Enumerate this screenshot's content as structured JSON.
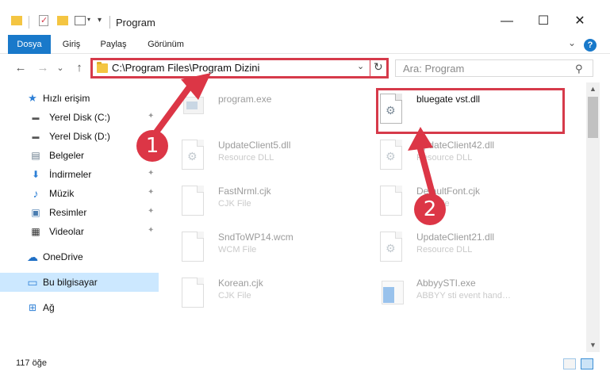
{
  "window": {
    "title": "Program",
    "minimize_glyph": "—",
    "maximize_glyph": "☐",
    "close_glyph": "✕"
  },
  "ribbon": {
    "tabs": [
      "Dosya",
      "Giriş",
      "Paylaş",
      "Görünüm"
    ],
    "expand_glyph": "⌄",
    "help_glyph": "?"
  },
  "nav": {
    "back_glyph": "←",
    "forward_glyph": "→",
    "recent_glyph": "⌄",
    "up_glyph": "↑"
  },
  "address": {
    "path": "C:\\Program Files\\Program Dizini",
    "dropdown_glyph": "⌄",
    "refresh_glyph": "↻"
  },
  "search": {
    "placeholder": "Ara: Program",
    "icon_glyph": "⚲"
  },
  "sidebar": {
    "items": [
      {
        "label": "Hızlı erişim",
        "icon": "star-icon",
        "glyph": "★",
        "color": "#2d7fd6"
      },
      {
        "label": "Yerel Disk (C:)",
        "icon": "drive-icon",
        "glyph": "▬",
        "color": "#555555",
        "pinned": true
      },
      {
        "label": "Yerel Disk (D:)",
        "icon": "drive-icon",
        "glyph": "▬",
        "color": "#555555"
      },
      {
        "label": "Belgeler",
        "icon": "documents-icon",
        "glyph": "▤",
        "color": "#6a7c8c"
      },
      {
        "label": "İndirmeler",
        "icon": "downloads-icon",
        "glyph": "⬇",
        "color": "#2d7fd6",
        "pinned": true
      },
      {
        "label": "Müzik",
        "icon": "music-icon",
        "glyph": "♪",
        "color": "#2d7fd6",
        "pinned": true
      },
      {
        "label": "Resimler",
        "icon": "pictures-icon",
        "glyph": "▣",
        "color": "#4a7db0",
        "pinned": true
      },
      {
        "label": "Videolar",
        "icon": "videos-icon",
        "glyph": "▦",
        "color": "#333333",
        "pinned": true
      },
      {
        "label": "OneDrive",
        "icon": "cloud-icon",
        "glyph": "☁",
        "color": "#1f6fc5"
      },
      {
        "label": "Bu bilgisayar",
        "icon": "computer-icon",
        "glyph": "▭",
        "color": "#2d7fd6",
        "selected": true
      },
      {
        "label": "Ağ",
        "icon": "network-icon",
        "glyph": "⊞",
        "color": "#2d7fd6"
      }
    ],
    "pin_glyph": "📌"
  },
  "files": [
    {
      "name": "program.exe",
      "type": "",
      "kind": "exe",
      "faded": true
    },
    {
      "name": "bluegate vst.dll",
      "type": "",
      "kind": "dll",
      "faded": false
    },
    {
      "name": "UpdateClient5.dll",
      "type": "Resource DLL",
      "kind": "dll",
      "faded": true
    },
    {
      "name": "UpdateClient42.dll",
      "type": "Resource DLL",
      "kind": "dll",
      "faded": true
    },
    {
      "name": "FastNrml.cjk",
      "type": "CJK File",
      "kind": "doc",
      "faded": true
    },
    {
      "name": "DefaultFont.cjk",
      "type": "CJK File",
      "kind": "doc",
      "faded": true
    },
    {
      "name": "SndToWP14.wcm",
      "type": "WCM File",
      "kind": "doc",
      "faded": true
    },
    {
      "name": "UpdateClient21.dll",
      "type": "Resource DLL",
      "kind": "dll",
      "faded": true
    },
    {
      "name": "Korean.cjk",
      "type": "CJK File",
      "kind": "doc",
      "faded": true
    },
    {
      "name": "AbbyySTI.exe",
      "type": "ABBYY sti event hand…",
      "kind": "exe",
      "faded": true
    }
  ],
  "scrollbar": {
    "up_glyph": "▲",
    "down_glyph": "▼"
  },
  "status": {
    "item_count": "117 öğe"
  },
  "callouts": {
    "one": "1",
    "two": "2"
  },
  "colors": {
    "accent": "#1979ca",
    "highlight": "#d63a4a",
    "callout": "#dc3646",
    "selection": "#cce8ff"
  }
}
